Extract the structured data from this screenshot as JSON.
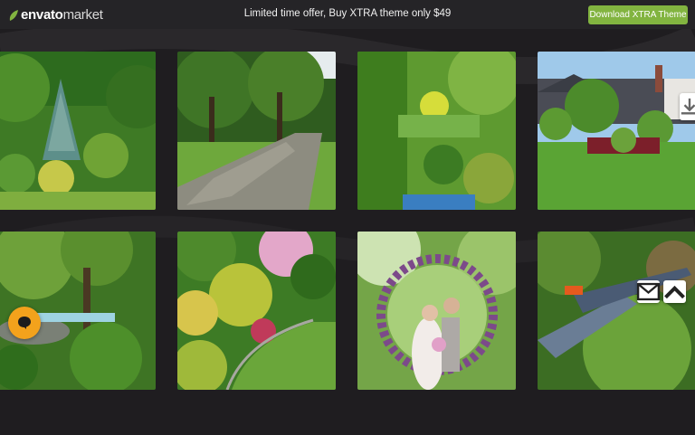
{
  "header": {
    "logo_primary": "envato",
    "logo_secondary": "market",
    "offer_text": "Limited time offer, Buy XTRA theme only $49",
    "cta_label": "Download XTRA Theme",
    "brand_color": "#82b440"
  },
  "gallery": {
    "items": [
      {
        "subject": "garden shrubs and conifers"
      },
      {
        "subject": "stone path through park"
      },
      {
        "subject": "hedge and flower bed"
      },
      {
        "subject": "lawn with house"
      },
      {
        "subject": "japanese garden with rocks"
      },
      {
        "subject": "curved garden border"
      },
      {
        "subject": "wedding couple in flower arch"
      },
      {
        "subject": "pruning shears trimming bush"
      }
    ]
  },
  "floating_controls": {
    "download_icon": "download-icon",
    "mail_icon": "mail-icon",
    "scroll_top_icon": "chevron-up-icon",
    "chat_icon": "chat-bubble-icon",
    "chat_color": "#f3a21c"
  }
}
